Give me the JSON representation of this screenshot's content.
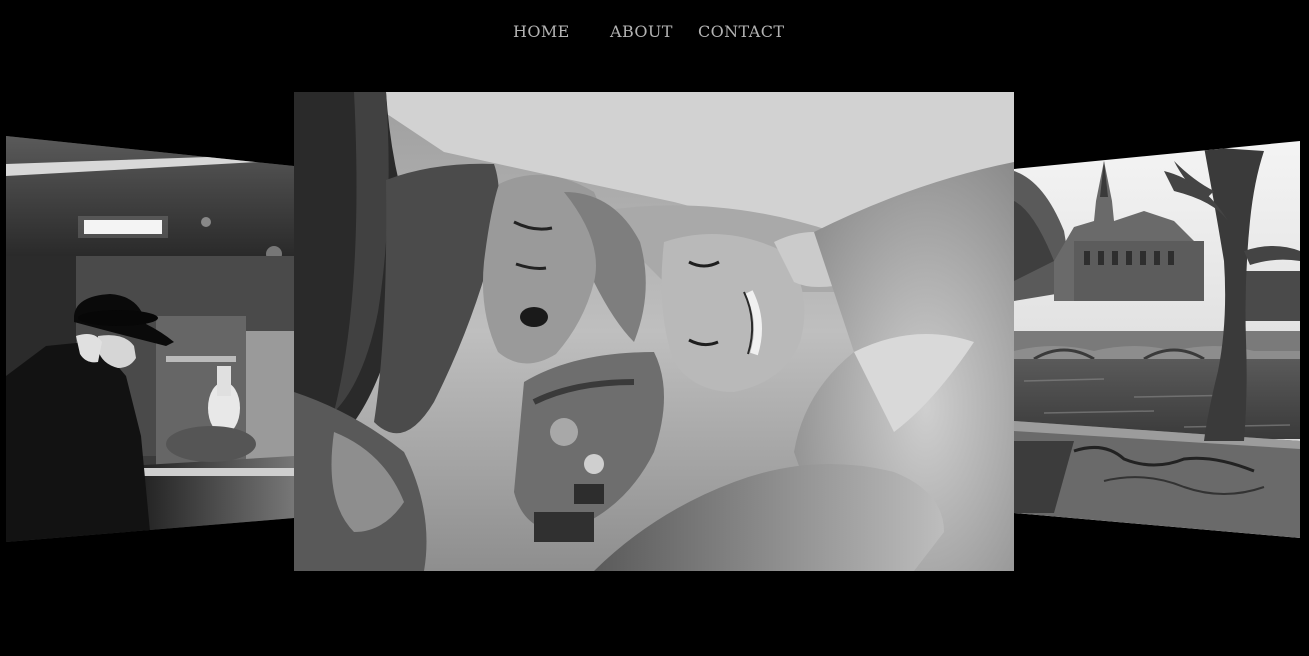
{
  "nav": {
    "items": [
      {
        "label": "HOME"
      },
      {
        "label": "ABOUT"
      },
      {
        "label": "CONTACT"
      }
    ]
  },
  "carousel": {
    "slides": [
      {
        "position": "left",
        "subject": "elderly man in hat at counter"
      },
      {
        "position": "center",
        "subject": "couple lying together"
      },
      {
        "position": "right",
        "subject": "cathedral by the river"
      }
    ]
  },
  "colors": {
    "background": "#000000",
    "nav_text": "#b3b3b3"
  }
}
